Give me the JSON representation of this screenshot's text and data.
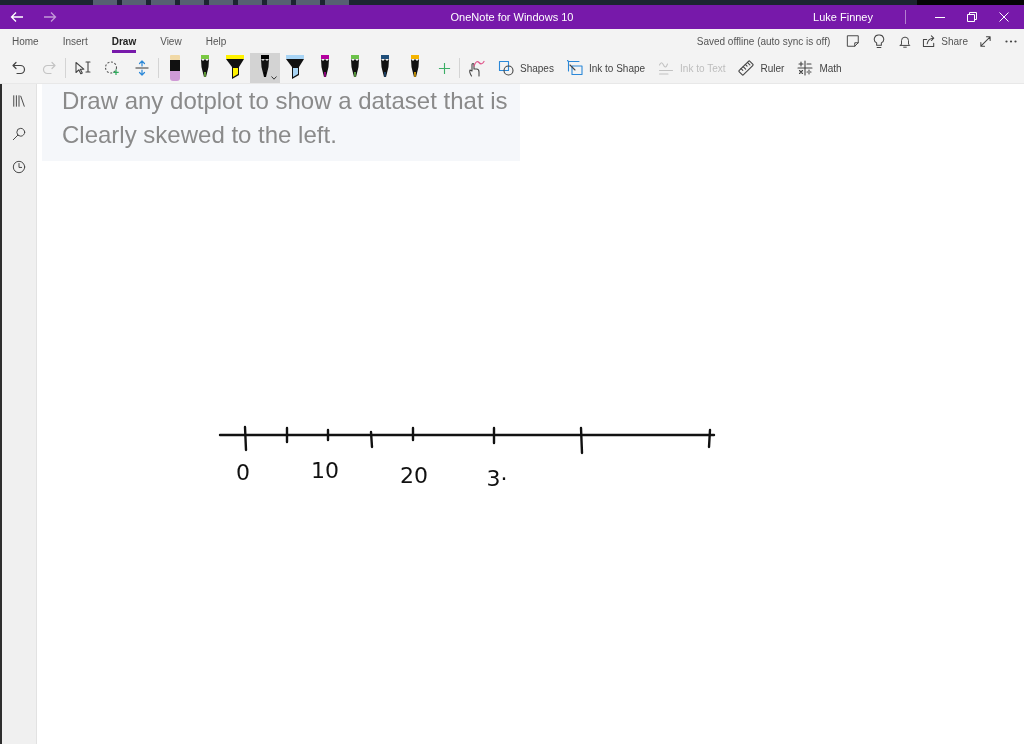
{
  "window": {
    "navigation": [
      {
        "kind": "back",
        "disabled": false
      },
      {
        "kind": "forward",
        "disabled": true
      }
    ],
    "title": "OneNote for Windows 10",
    "user": "Luke Finney"
  },
  "ribbon": {
    "tabs": [
      {
        "label": "Home",
        "selected": false
      },
      {
        "label": "Insert",
        "selected": false
      },
      {
        "label": "Draw",
        "selected": true
      },
      {
        "label": "View",
        "selected": false
      },
      {
        "label": "Help",
        "selected": false
      }
    ],
    "sync_status": "Saved offline (auto sync is off)",
    "share_label": "Share"
  },
  "toolbar": {
    "history": [
      {
        "kind": "undo",
        "disabled": false
      },
      {
        "kind": "redo",
        "disabled": true
      }
    ],
    "pens": [
      {
        "kind": "eraser",
        "color": "#cf9ad6",
        "selected": false
      },
      {
        "kind": "pen",
        "color": "#7ac943",
        "selected": false
      },
      {
        "kind": "highlighter",
        "color": "#fff200",
        "selected": false
      },
      {
        "kind": "pen",
        "color": "#000000",
        "selected": true
      },
      {
        "kind": "highlighter",
        "color": "#a8d4f5",
        "selected": false
      },
      {
        "kind": "pen",
        "color": "#b4009e",
        "selected": false
      },
      {
        "kind": "pen",
        "color": "#6cc24a",
        "selected": false
      },
      {
        "kind": "pen",
        "color": "#1f4e79",
        "selected": false
      },
      {
        "kind": "pen",
        "color": "#f5b400",
        "selected": false
      }
    ],
    "ink_tools": [
      {
        "kind": "shapes",
        "label": "Shapes",
        "disabled": false
      },
      {
        "kind": "ink-to-shape",
        "label": "Ink to Shape",
        "disabled": false
      },
      {
        "kind": "ink-to-text",
        "label": "Ink to Text",
        "disabled": true
      },
      {
        "kind": "ruler",
        "label": "Ruler",
        "disabled": false
      },
      {
        "kind": "math",
        "label": "Math",
        "disabled": false
      }
    ]
  },
  "page": {
    "note_text": "Draw any dotplot to show a dataset that is\nClearly skewed to the left.",
    "number_line_labels": [
      "0",
      "10",
      "20",
      "3·"
    ]
  }
}
